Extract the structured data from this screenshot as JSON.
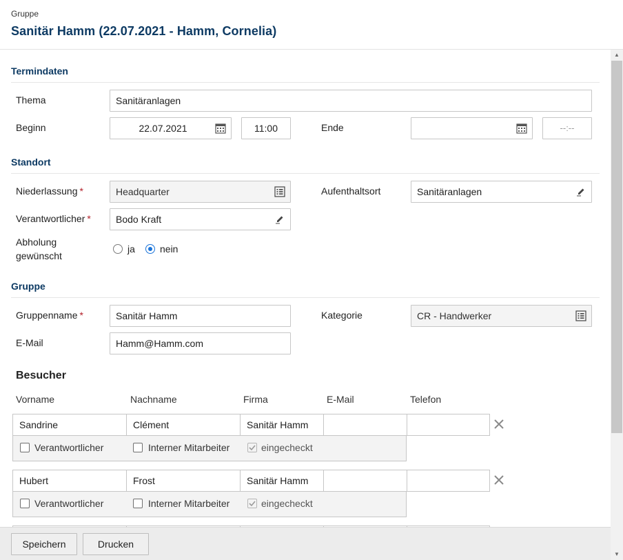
{
  "header": {
    "label": "Gruppe",
    "title": "Sanitär Hamm (22.07.2021 - Hamm, Cornelia)"
  },
  "termindaten": {
    "section_title": "Termindaten",
    "thema_label": "Thema",
    "thema_value": "Sanitäranlagen",
    "beginn_label": "Beginn",
    "beginn_date": "22.07.2021",
    "beginn_time": "11:00",
    "ende_label": "Ende",
    "ende_date": "",
    "ende_time_placeholder": "--:--"
  },
  "standort": {
    "section_title": "Standort",
    "niederlassung_label": "Niederlassung",
    "niederlassung_value": "Headquarter",
    "aufenthaltsort_label": "Aufenthaltsort",
    "aufenthaltsort_value": "Sanitäranlagen",
    "verantwortlicher_label": "Verantwortlicher",
    "verantwortlicher_value": "Bodo Kraft",
    "abholung_label_line1": "Abholung",
    "abholung_label_line2": "gewünscht",
    "abholung_options": [
      "ja",
      "nein"
    ],
    "abholung_selected": "nein",
    "required_mark": "*"
  },
  "gruppe": {
    "section_title": "Gruppe",
    "gruppenname_label": "Gruppenname",
    "gruppenname_value": "Sanitär Hamm",
    "kategorie_label": "Kategorie",
    "kategorie_value": "CR - Handwerker",
    "email_label": "E-Mail",
    "email_value": "Hamm@Hamm.com"
  },
  "besucher": {
    "title": "Besucher",
    "columns": [
      "Vorname",
      "Nachname",
      "Firma",
      "E-Mail",
      "Telefon"
    ],
    "checkbox_labels": [
      "Verantwortlicher",
      "Interner Mitarbeiter",
      "eingecheckt"
    ],
    "rows": [
      {
        "vorname": "Sandrine",
        "nachname": "Clément",
        "firma": "Sanitär Hamm",
        "email": "",
        "telefon": "",
        "verantwortlicher": false,
        "intern": false,
        "eingecheckt": true
      },
      {
        "vorname": "Hubert",
        "nachname": "Frost",
        "firma": "Sanitär Hamm",
        "email": "",
        "telefon": "",
        "verantwortlicher": false,
        "intern": false,
        "eingecheckt": true
      }
    ]
  },
  "footer": {
    "save_label": "Speichern",
    "print_label": "Drucken"
  },
  "colors": {
    "accent": "#0d3a63",
    "radio": "#1a73d9",
    "required": "#b3202a"
  }
}
